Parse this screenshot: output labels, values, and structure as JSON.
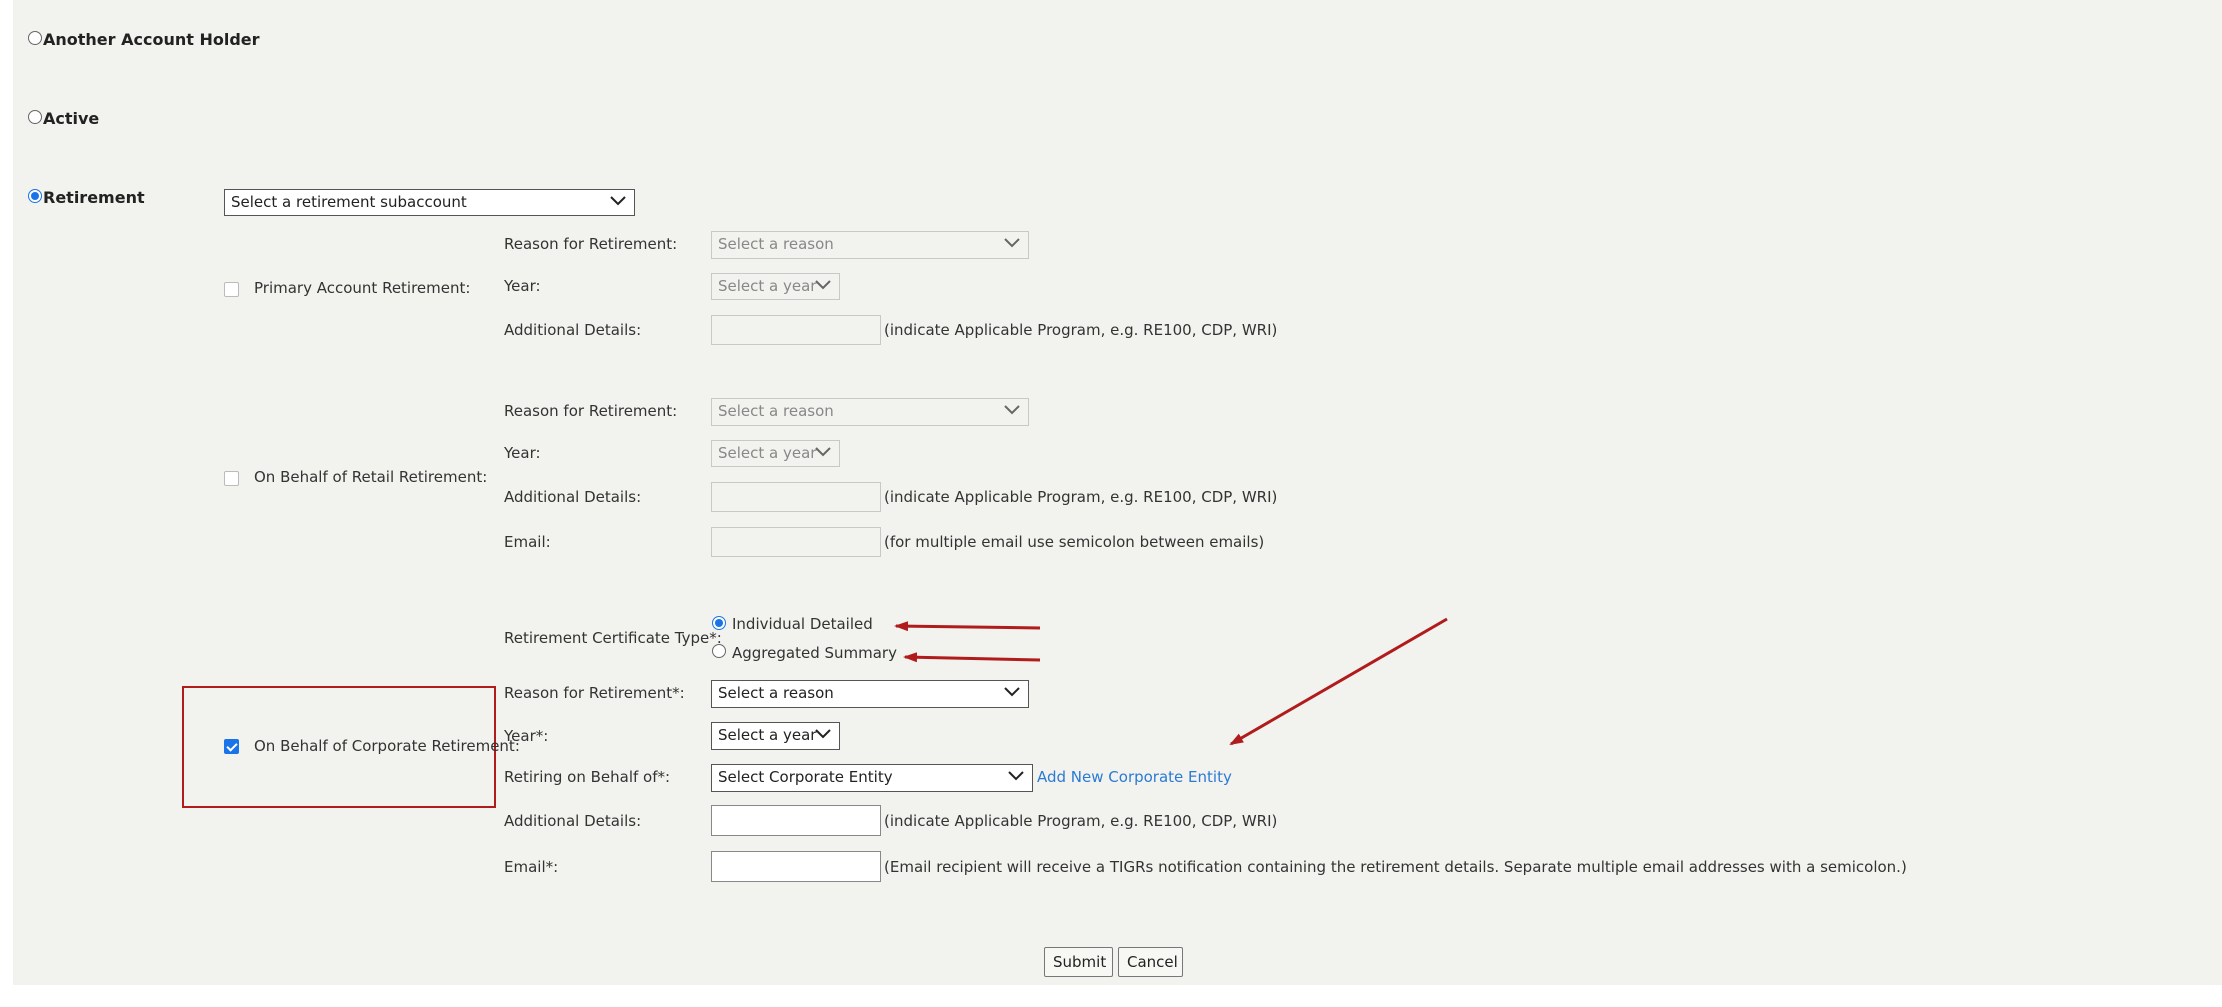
{
  "account_options": {
    "another_holder": "Another Account Holder",
    "active": "Active",
    "retirement": "Retirement"
  },
  "subaccount_select": {
    "value": "Select a retirement subaccount"
  },
  "primary": {
    "checkbox_label": "Primary Account Retirement:",
    "reason_label": "Reason for Retirement:",
    "reason_value": "Select a reason",
    "year_label": "Year:",
    "year_value": "Select a year",
    "details_label": "Additional Details:",
    "details_note": "(indicate Applicable Program, e.g. RE100, CDP, WRI)"
  },
  "retail": {
    "checkbox_label": "On Behalf of Retail Retirement:",
    "reason_label": "Reason for Retirement:",
    "reason_value": "Select a reason",
    "year_label": "Year:",
    "year_value": "Select a year",
    "details_label": "Additional Details:",
    "details_note": "(indicate Applicable Program, e.g. RE100, CDP, WRI)",
    "email_label": "Email:",
    "email_note": "(for multiple email use semicolon between emails)"
  },
  "corporate": {
    "checkbox_label": "On Behalf of Corporate Retirement:",
    "cert_type_label": "Retirement Certificate Type*:",
    "cert_individual": "Individual Detailed",
    "cert_aggregated": "Aggregated Summary",
    "reason_label": "Reason for Retirement*:",
    "reason_value": "Select a reason",
    "year_label": "Year*:",
    "year_value": "Select a year",
    "behalf_label": "Retiring on Behalf of*:",
    "behalf_value": "Select Corporate Entity",
    "add_entity_link": "Add New Corporate Entity",
    "details_label": "Additional Details:",
    "details_note": "(indicate Applicable Program, e.g. RE100, CDP, WRI)",
    "email_label": "Email*:",
    "email_note": "(Email recipient will receive a TIGRs notification containing the retirement details. Separate multiple email addresses with a semicolon.)"
  },
  "buttons": {
    "submit": "Submit",
    "cancel": "Cancel"
  },
  "colors": {
    "accent": "#1a73e8",
    "annotation": "#b01c1c",
    "link": "#2a7bd4",
    "panel": "#f2f2ee"
  }
}
